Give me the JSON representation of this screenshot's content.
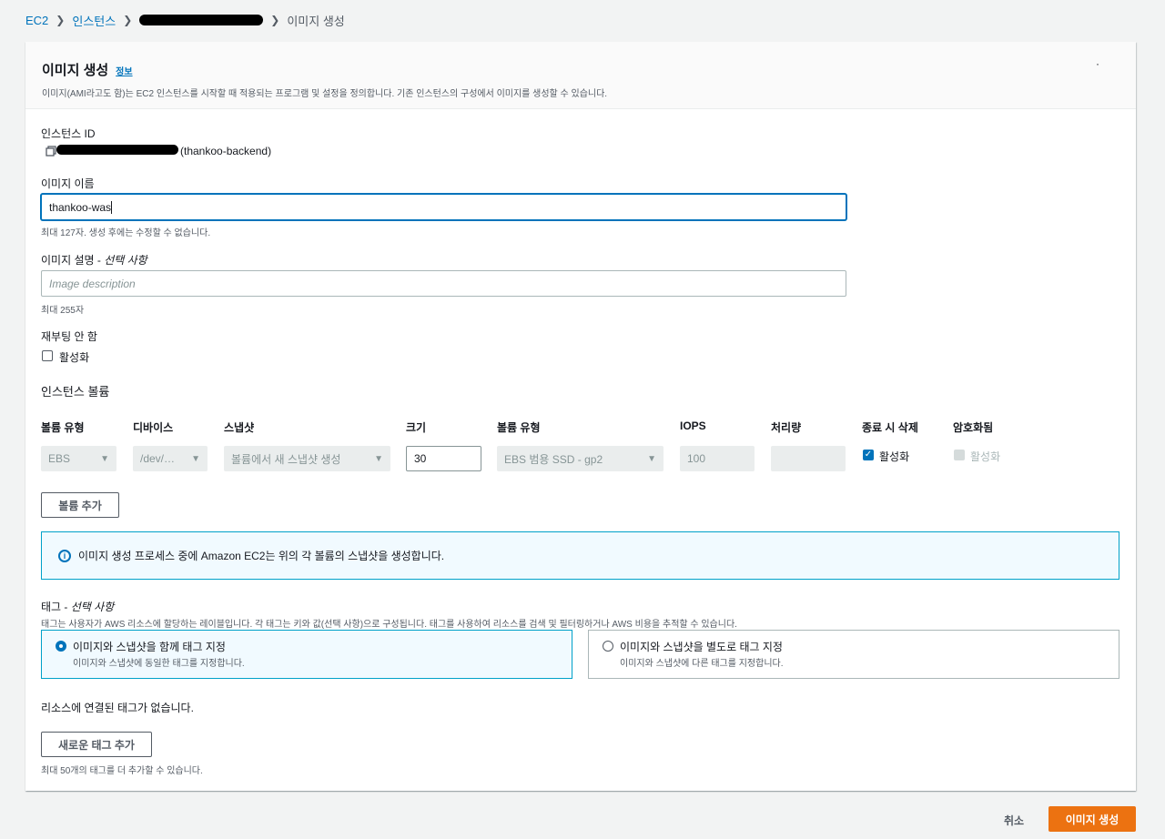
{
  "breadcrumb": {
    "ec2": "EC2",
    "instances": "인스턴스",
    "current": "이미지 생성"
  },
  "header": {
    "title": "이미지 생성",
    "info": "정보",
    "description": "이미지(AMI라고도 함)는 EC2 인스턴스를 시작할 때 적용되는 프로그램 및 설정을 정의합니다. 기존 인스턴스의 구성에서 이미지를 생성할 수 있습니다.",
    "dot": "·"
  },
  "instance_id": {
    "label": "인스턴스 ID",
    "name": "(thankoo-backend)"
  },
  "image_name": {
    "label": "이미지 이름",
    "value": "thankoo-was",
    "hint": "최대 127자. 생성 후에는 수정할 수 없습니다."
  },
  "image_description": {
    "label": "이미지 설명 - ",
    "optional": "선택 사항",
    "placeholder": "Image description",
    "hint": "최대 255자"
  },
  "no_reboot": {
    "label": "재부팅 안 함",
    "checkbox_label": "활성화"
  },
  "volumes": {
    "section_title": "인스턴스 볼륨",
    "columns": [
      "볼륨 유형",
      "디바이스",
      "스냅샷",
      "크기",
      "볼륨 유형",
      "IOPS",
      "처리량",
      "종료 시 삭제",
      "암호화됨"
    ],
    "row": {
      "volume_type": "EBS",
      "device": "/dev/…",
      "snapshot": "볼륨에서 새 스냅샷 생성",
      "size": "30",
      "ebs_type": "EBS 범용 SSD - gp2",
      "iops": "100",
      "throughput": "",
      "delete_on_termination": "활성화",
      "encrypted": "활성화"
    },
    "add_button": "볼륨 추가"
  },
  "alert": {
    "text": "이미지 생성 프로세스 중에 Amazon EC2는 위의 각 볼륨의 스냅샷을 생성합니다.",
    "icon": "i"
  },
  "tags": {
    "label": "태그 - ",
    "optional": "선택 사항",
    "description": "태그는 사용자가 AWS 리소스에 할당하는 레이블입니다. 각 태그는 키와 값(선택 사항)으로 구성됩니다. 태그를 사용하여 리소스를 검색 및 필터링하거나 AWS 비용을 추적할 수 있습니다.",
    "option_together": {
      "title": "이미지와 스냅샷을 함께 태그 지정",
      "desc": "이미지와 스냅샷에 동일한 태그를 지정합니다."
    },
    "option_separate": {
      "title": "이미지와 스냅샷을 별도로 태그 지정",
      "desc": "이미지와 스냅샷에 다른 태그를 지정합니다."
    },
    "empty_text": "리소스에 연결된 태그가 없습니다.",
    "add_button": "새로운 태그 추가",
    "limit_hint": "최대 50개의 태그를 더 추가할 수 있습니다."
  },
  "footer": {
    "cancel": "취소",
    "create": "이미지 생성"
  },
  "colors": {
    "accent": "#0073bb",
    "primary_button": "#ec7211"
  }
}
